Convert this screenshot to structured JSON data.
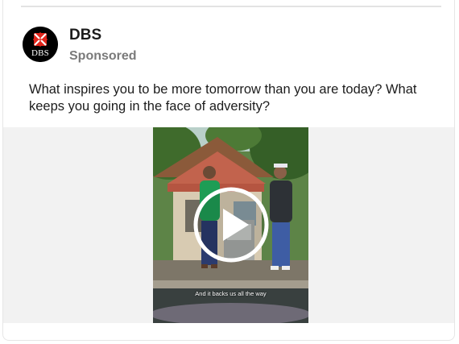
{
  "post": {
    "advertiser": "DBS",
    "sponsored_label": "Sponsored",
    "logo_text": "DBS",
    "caption": "What inspires you to be more tomorrow than you are today? What keeps you going in the face of adversity?"
  },
  "video": {
    "subtitle": "And it backs us all the way",
    "play_icon": "play-icon"
  },
  "colors": {
    "logo_red": "#e0251b",
    "text_primary": "#1c1c1c",
    "text_secondary": "#7a7a7a",
    "media_background": "#f2f2f2"
  }
}
